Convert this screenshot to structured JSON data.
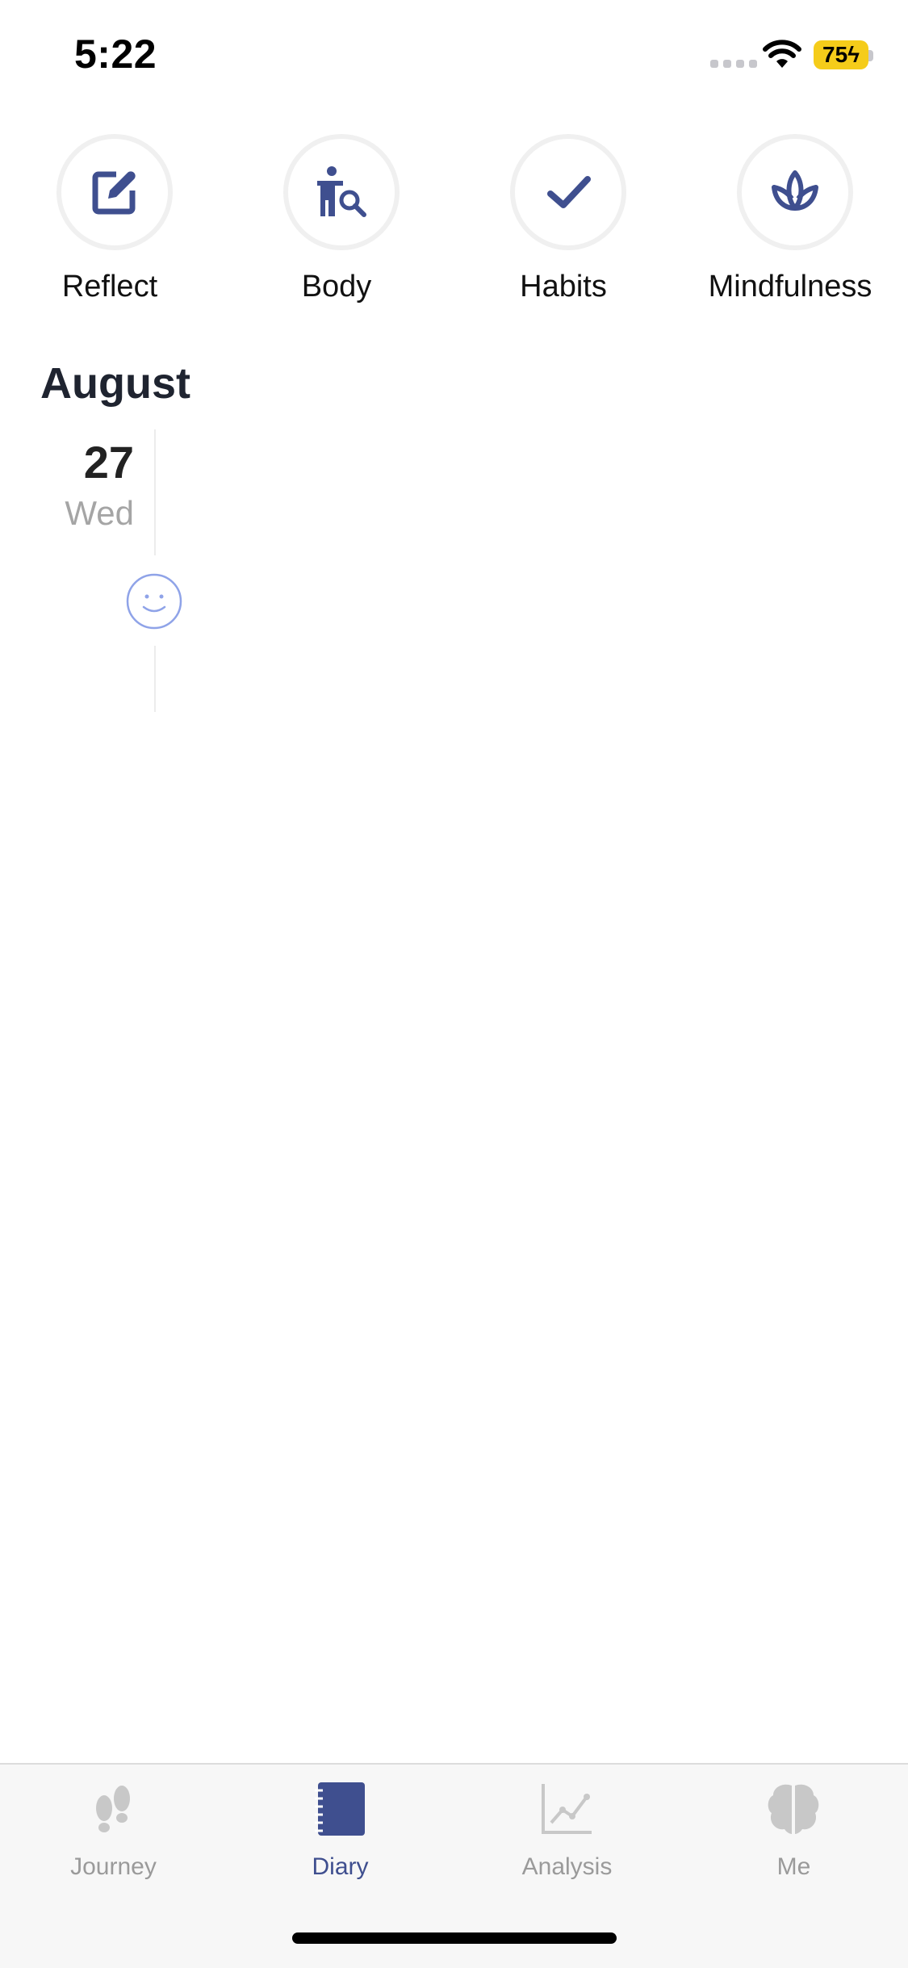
{
  "status_bar": {
    "time": "5:22",
    "battery": "75"
  },
  "quick_actions": [
    {
      "label": "Reflect",
      "icon": "edit-icon"
    },
    {
      "label": "Body",
      "icon": "body-scan-icon"
    },
    {
      "label": "Habits",
      "icon": "checkmark-icon"
    },
    {
      "label": "Mindfulness",
      "icon": "lotus-icon"
    }
  ],
  "diary": {
    "month": "August",
    "entries": [
      {
        "day": "27",
        "weekday": "Wed",
        "mood_icon": "smiley-face-icon"
      }
    ]
  },
  "tab_bar": {
    "active": "Diary",
    "tabs": [
      {
        "label": "Journey",
        "icon": "footprints-icon"
      },
      {
        "label": "Diary",
        "icon": "notebook-icon"
      },
      {
        "label": "Analysis",
        "icon": "line-chart-icon"
      },
      {
        "label": "Me",
        "icon": "brain-icon"
      }
    ]
  },
  "colors": {
    "accent": "#3f4f8f",
    "mood": "#8fa3e8",
    "inactive": "#c8c8c8",
    "battery": "#f5cc1a"
  }
}
